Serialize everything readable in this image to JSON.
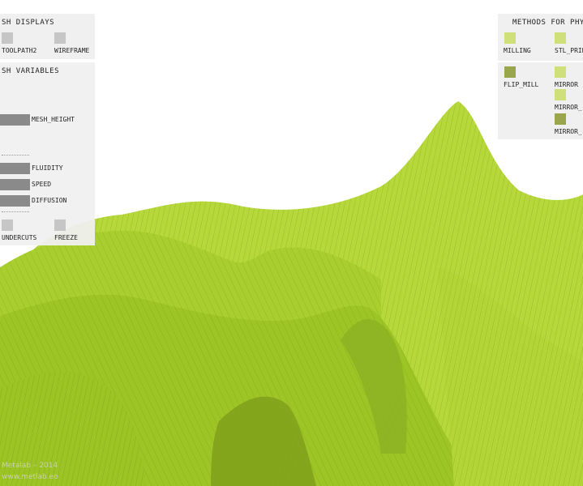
{
  "mesh_displays": {
    "title": "SH DISPLAYS",
    "toggles": [
      {
        "label": "TOOLPATH2",
        "checked": false
      },
      {
        "label": "WIREFRAME",
        "checked": false
      }
    ]
  },
  "mesh_variables": {
    "title": "SH VARIABLES",
    "sliders": [
      {
        "label": "MESH_HEIGHT",
        "value": 1
      },
      {
        "label": "FLUIDITY",
        "value": 1
      },
      {
        "label": "SPEED",
        "value": 1
      },
      {
        "label": "DIFFUSION",
        "value": 1
      }
    ],
    "toggles": [
      {
        "label": "UNDERCUTS",
        "checked": false
      },
      {
        "label": "FREEZE",
        "checked": false
      }
    ]
  },
  "methods": {
    "title": "METHODS FOR PHY",
    "items": [
      {
        "label": "MILLING",
        "color": "#cfe07a"
      },
      {
        "label": "STL_PRIN",
        "color": "#cfe07a"
      },
      {
        "label": "FLIP_MILL",
        "color": "#9aa64c"
      },
      {
        "label": "MIRROR",
        "color": "#cfe07a"
      },
      {
        "label": "MIRROR_",
        "color": "#cfe07a"
      },
      {
        "label": "MIRROR_",
        "color": "#9aa64c"
      }
    ]
  },
  "watermark": {
    "line1": "Metalab – 2014",
    "line2": "www.metlab.eo"
  },
  "mesh_color": "#a6cc2a"
}
